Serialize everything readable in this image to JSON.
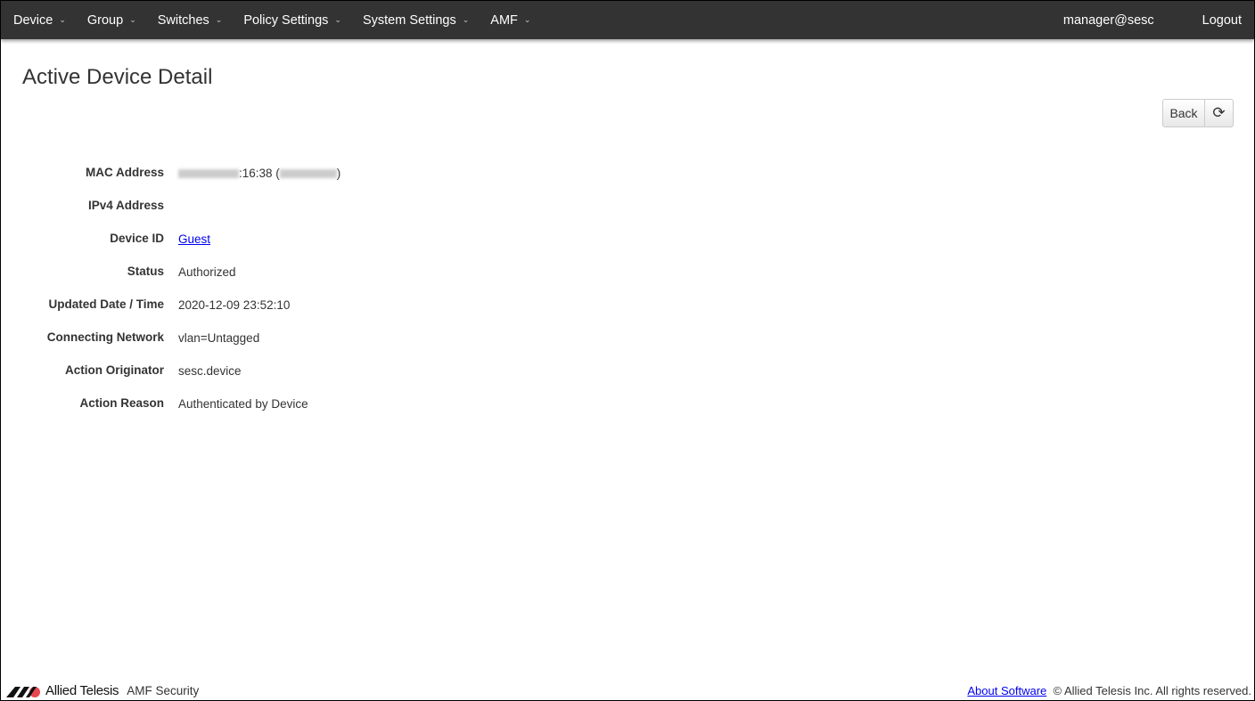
{
  "nav": {
    "items": [
      "Device",
      "Group",
      "Switches",
      "Policy Settings",
      "System Settings",
      "AMF"
    ],
    "user": "manager@sesc",
    "logout": "Logout"
  },
  "page": {
    "title": "Active Device Detail",
    "back": "Back"
  },
  "details": {
    "mac_label": "MAC Address",
    "mac_suffix": ":16:38 (",
    "mac_close": ")",
    "ipv4_label": "IPv4 Address",
    "ipv4_value": "",
    "device_id_label": "Device ID",
    "device_id_value": "Guest",
    "status_label": "Status",
    "status_value": "Authorized",
    "updated_label": "Updated Date / Time",
    "updated_value": "2020-12-09 23:52:10",
    "network_label": "Connecting Network",
    "network_value": "vlan=Untagged",
    "originator_label": "Action Originator",
    "originator_value": "sesc.device",
    "reason_label": "Action Reason",
    "reason_value": "Authenticated by Device"
  },
  "footer": {
    "brand": "Allied Telesis",
    "product": "AMF Security",
    "about": "About Software",
    "copyright": "© Allied Telesis Inc. All rights reserved."
  }
}
